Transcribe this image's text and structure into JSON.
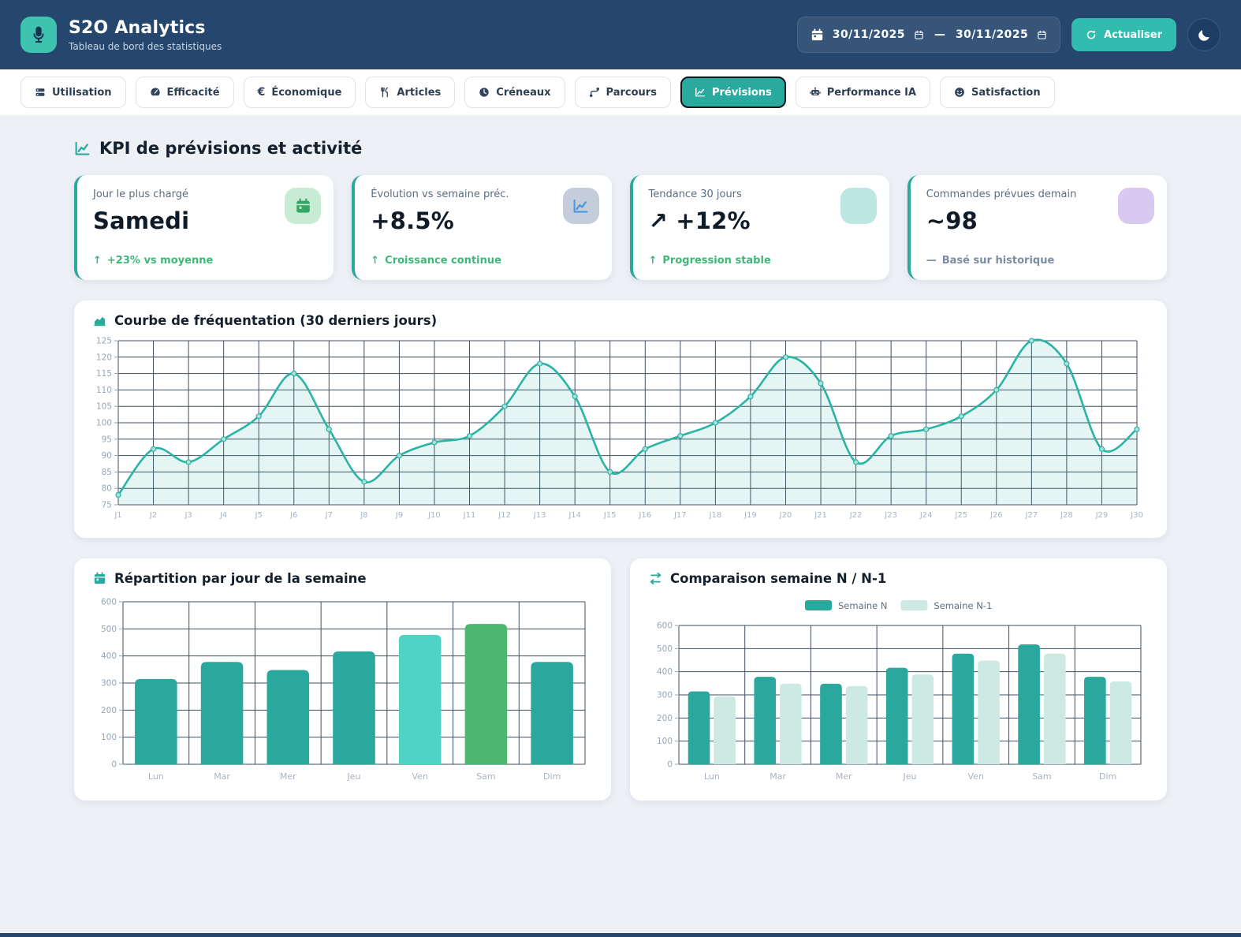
{
  "header": {
    "app_title": "S2O Analytics",
    "app_subtitle": "Tableau de bord des statistiques",
    "date_from": "30/11/2025",
    "date_separator": "—",
    "date_to": "30/11/2025",
    "refresh_label": "Actualiser"
  },
  "tabs": [
    {
      "label": "Utilisation",
      "icon": "stack",
      "active": false
    },
    {
      "label": "Efficacité",
      "icon": "gauge",
      "active": false
    },
    {
      "label": "Économique",
      "icon": "euro",
      "active": false
    },
    {
      "label": "Articles",
      "icon": "utensils",
      "active": false
    },
    {
      "label": "Créneaux",
      "icon": "clock",
      "active": false
    },
    {
      "label": "Parcours",
      "icon": "route",
      "active": false
    },
    {
      "label": "Prévisions",
      "icon": "chart-line",
      "active": true
    },
    {
      "label": "Performance IA",
      "icon": "robot",
      "active": false
    },
    {
      "label": "Satisfaction",
      "icon": "smiley",
      "active": false
    }
  ],
  "kpi": {
    "section_title": "KPI de prévisions et activité",
    "section_icon": "chart-line",
    "cards": [
      {
        "label": "Jour le plus chargé",
        "value": "Samedi",
        "trend_icon": "↑",
        "trend": "+23% vs moyenne",
        "trend_color": "#3cb878",
        "badge_icon": "calendar",
        "badge_bg": "#c7ecd3",
        "badge_color": "#35a665"
      },
      {
        "label": "Évolution vs semaine préc.",
        "value": "+8.5%",
        "trend_icon": "↑",
        "trend": "Croissance continue",
        "trend_color": "#3cb878",
        "badge_icon": "chart-line",
        "badge_bg": "#c3ceda",
        "badge_color": "#4a97e0"
      },
      {
        "label": "Tendance 30 jours",
        "value": "↗ +12%",
        "trend_icon": "↑",
        "trend": "Progression stable",
        "trend_color": "#3cb878",
        "badge_icon": "",
        "badge_bg": "#bde8e1",
        "badge_color": "#bde8e1"
      },
      {
        "label": "Commandes prévues demain",
        "value": "~98",
        "trend_icon": "—",
        "trend": "Basé sur historique",
        "trend_color": "#7c8ca0",
        "badge_icon": "",
        "badge_bg": "#d9c9f1",
        "badge_color": "#d9c9f1"
      }
    ]
  },
  "chart_data": [
    {
      "type": "area",
      "title": "Courbe de fréquentation (30 derniers jours)",
      "icon": "area-chart",
      "x": [
        "J1",
        "J2",
        "J3",
        "J4",
        "J5",
        "J6",
        "J7",
        "J8",
        "J9",
        "J10",
        "J11",
        "J12",
        "J13",
        "J14",
        "J15",
        "J16",
        "J17",
        "J18",
        "J19",
        "J20",
        "J21",
        "J22",
        "J23",
        "J24",
        "J25",
        "J26",
        "J27",
        "J28",
        "J29",
        "J30"
      ],
      "values": [
        78,
        92,
        88,
        95,
        102,
        115,
        98,
        82,
        90,
        94,
        96,
        105,
        118,
        108,
        85,
        92,
        96,
        100,
        108,
        120,
        112,
        88,
        96,
        98,
        102,
        110,
        125,
        118,
        92,
        98
      ],
      "ylim": [
        75,
        125
      ],
      "ytick": 5,
      "grid": true,
      "line_color": "#2bb3a6",
      "fill_color": "rgba(43,179,166,0.13)"
    },
    {
      "type": "bar",
      "title": "Répartition par jour de la semaine",
      "icon": "calendar",
      "categories": [
        "Lun",
        "Mar",
        "Mer",
        "Jeu",
        "Ven",
        "Sam",
        "Dim"
      ],
      "values": [
        315,
        378,
        348,
        417,
        478,
        518,
        378
      ],
      "bar_colors": [
        "#2aa89d",
        "#2aa89d",
        "#2aa89d",
        "#2aa89d",
        "#50d2c4",
        "#4db770",
        "#2aa89d"
      ],
      "ylim": [
        0,
        600
      ],
      "ytick": 100,
      "grid": true
    },
    {
      "type": "grouped-bar",
      "title": "Comparaison semaine N / N-1",
      "icon": "swap",
      "categories": [
        "Lun",
        "Mar",
        "Mer",
        "Jeu",
        "Ven",
        "Sam",
        "Dim"
      ],
      "series": [
        {
          "name": "Semaine N",
          "color": "#2aa89d",
          "values": [
            315,
            378,
            348,
            417,
            478,
            518,
            378
          ]
        },
        {
          "name": "Semaine N-1",
          "color": "#cde9e4",
          "values": [
            293,
            348,
            338,
            388,
            448,
            478,
            358
          ]
        }
      ],
      "ylim": [
        0,
        600
      ],
      "ytick": 100,
      "legend_position": "top",
      "grid": true
    }
  ]
}
